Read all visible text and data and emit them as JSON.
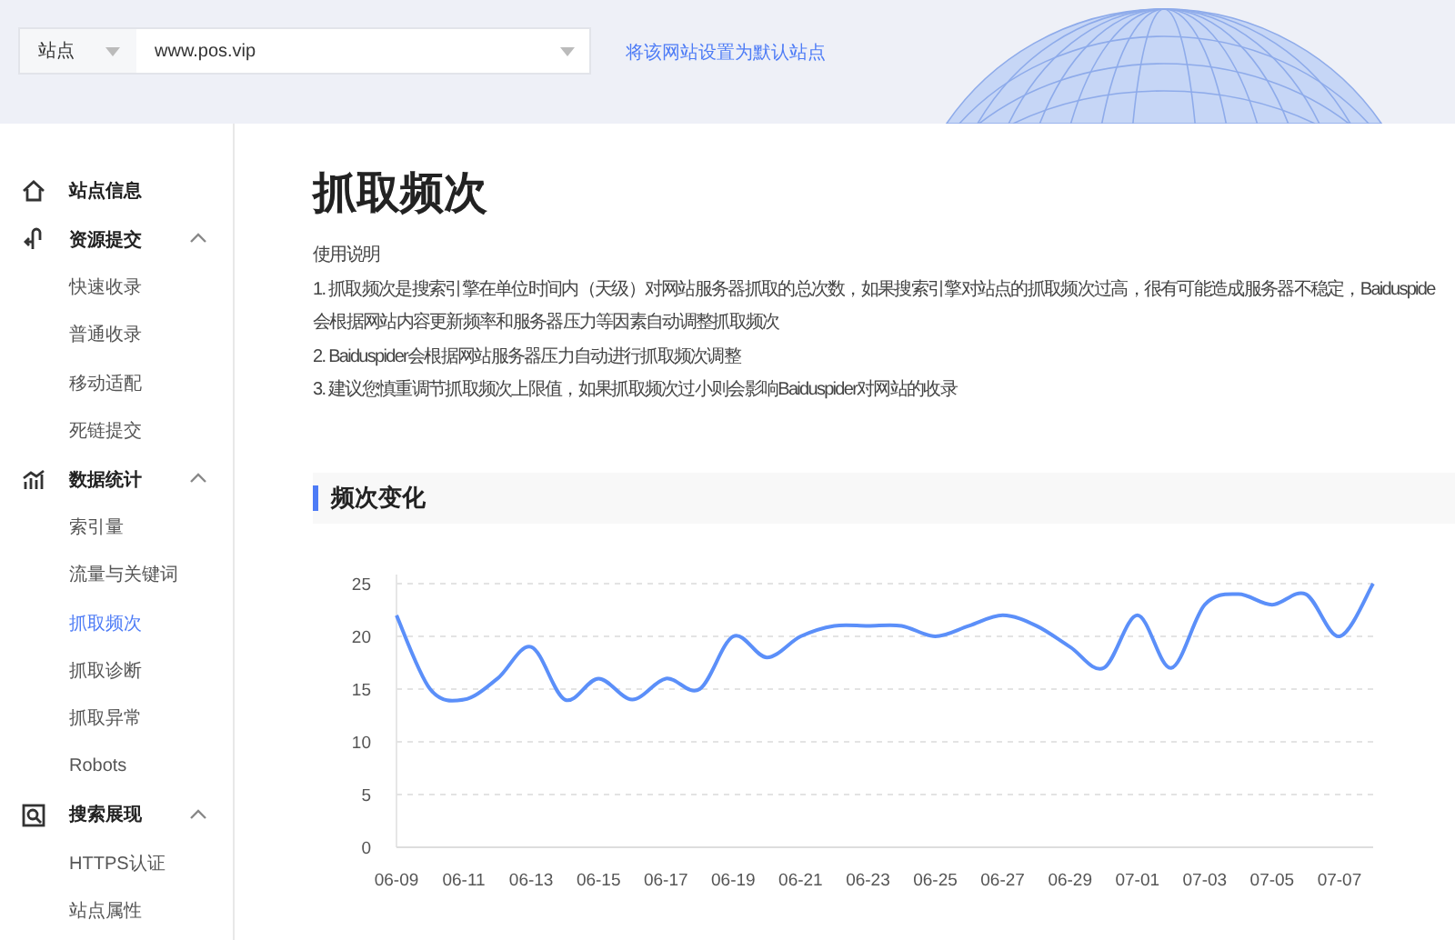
{
  "site_selector": {
    "type_label": "站点",
    "url": "www.pos.vip"
  },
  "default_link": "将该网站设置为默认站点",
  "sidebar": {
    "items": [
      {
        "label": "站点信息",
        "kind": "top",
        "selected": false
      },
      {
        "label": "资源提交",
        "kind": "group",
        "expanded": true,
        "children": [
          {
            "label": "快速收录",
            "selected": false
          },
          {
            "label": "普通收录",
            "selected": false
          },
          {
            "label": "移动适配",
            "selected": false
          },
          {
            "label": "死链提交",
            "selected": false
          }
        ]
      },
      {
        "label": "数据统计",
        "kind": "group",
        "expanded": true,
        "children": [
          {
            "label": "索引量",
            "selected": false
          },
          {
            "label": "流量与关键词",
            "selected": false
          },
          {
            "label": "抓取频次",
            "selected": true
          },
          {
            "label": "抓取诊断",
            "selected": false
          },
          {
            "label": "抓取异常",
            "selected": false
          },
          {
            "label": "Robots",
            "selected": false
          }
        ]
      },
      {
        "label": "搜索展现",
        "kind": "group",
        "expanded": true,
        "children": [
          {
            "label": "HTTPS认证",
            "selected": false
          },
          {
            "label": "站点属性",
            "selected": false
          }
        ]
      }
    ]
  },
  "main": {
    "title": "抓取频次",
    "intro_heading": "使用说明",
    "note_lines": [
      "1. 抓取频次是搜索引擎在单位时间内（天级）对网站服务器抓取的总次数，如果搜索引擎对站点的抓取频次过高，很有可能造成服务器不稳定，Baiduspide",
      "会根据网站内容更新频率和服务器压力等因素自动调整抓取频次",
      "2. Baiduspider会根据网站服务器压力自动进行抓取频次调整",
      "3. 建议您慎重调节抓取频次上限值，如果抓取频次过小则会影响Baiduspider对网站的收录"
    ],
    "section_title": "频次变化",
    "chart_data": {
      "type": "line",
      "categories": [
        "06-09",
        null,
        "06-11",
        null,
        "06-13",
        null,
        "06-15",
        null,
        "06-17",
        null,
        "06-19",
        null,
        "06-21",
        null,
        "06-23",
        null,
        "06-25",
        null,
        "06-27",
        null,
        "06-29",
        null,
        "07-01",
        null,
        "07-03",
        null,
        "07-05",
        null,
        "07-07",
        null
      ],
      "grid": true,
      "series": [
        {
          "color": "#5b8ff9",
          "values": [
            22,
            15,
            14,
            16,
            19,
            14,
            16,
            14,
            16,
            15,
            20,
            18,
            20,
            21,
            21,
            21,
            20,
            21,
            22,
            21,
            19,
            17,
            22,
            17,
            23,
            24,
            23,
            24,
            20,
            25
          ]
        }
      ],
      "ylim": [
        0,
        25
      ],
      "yticks": [
        0,
        5,
        10,
        15,
        20,
        25
      ]
    }
  }
}
